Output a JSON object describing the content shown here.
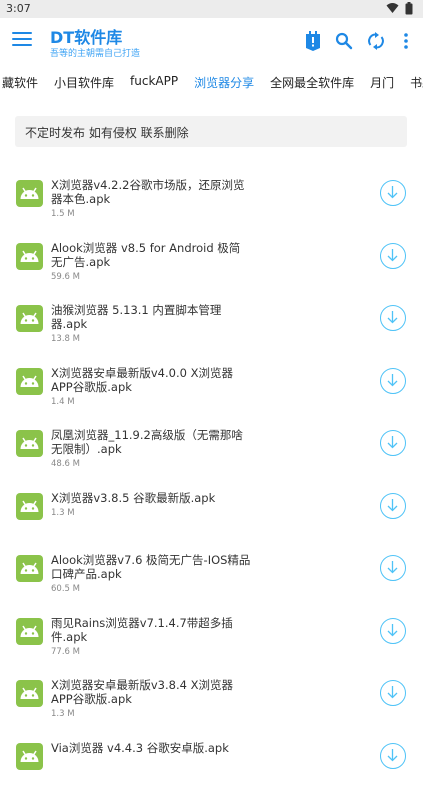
{
  "status_bar": {
    "time": "3:07"
  },
  "app_bar": {
    "title": "DT软件库",
    "subtitle": "吾等的主朝需自己打造"
  },
  "tabs": [
    {
      "label": "藏软件",
      "active": false
    },
    {
      "label": "小目软件库",
      "active": false
    },
    {
      "label": "fuckAPP",
      "active": false
    },
    {
      "label": "浏览器分享",
      "active": true
    },
    {
      "label": "全网最全软件库",
      "active": false
    },
    {
      "label": "月门",
      "active": false
    },
    {
      "label": "书森软",
      "active": false
    }
  ],
  "notice": {
    "text": "不定时发布 如有侵权 联系删除"
  },
  "items": [
    {
      "title": "X浏览器v4.2.2谷歌市场版，还原浏览器本色.apk",
      "size": "1.5 M"
    },
    {
      "title": "Alook浏览器 v8.5 for Android 极简无广告.apk",
      "size": "59.6 M"
    },
    {
      "title": "油猴浏览器 5.13.1 内置脚本管理器.apk",
      "size": "13.8 M"
    },
    {
      "title": "X浏览器安卓最新版v4.0.0 X浏览器APP谷歌版.apk",
      "size": "1.4 M"
    },
    {
      "title": "凤凰浏览器_11.9.2高级版（无需那啥无限制）.apk",
      "size": "48.6 M"
    },
    {
      "title": "X浏览器v3.8.5 谷歌最新版.apk",
      "size": "1.3 M"
    },
    {
      "title": "Alook浏览器v7.6 极简无广告-IOS精品口碑产品.apk",
      "size": "60.5 M"
    },
    {
      "title": "雨见Rains浏览器v7.1.4.7带超多插件.apk",
      "size": "77.6 M"
    },
    {
      "title": "X浏览器安卓最新版v3.8.4 X浏览器APP谷歌版.apk",
      "size": "1.3 M"
    },
    {
      "title": "Via浏览器 v4.4.3 谷歌安卓版.apk",
      "size": ""
    }
  ],
  "colors": {
    "accent": "#1e88e5",
    "android_green": "#8bc34a",
    "download_ring": "#4fc3f7"
  }
}
